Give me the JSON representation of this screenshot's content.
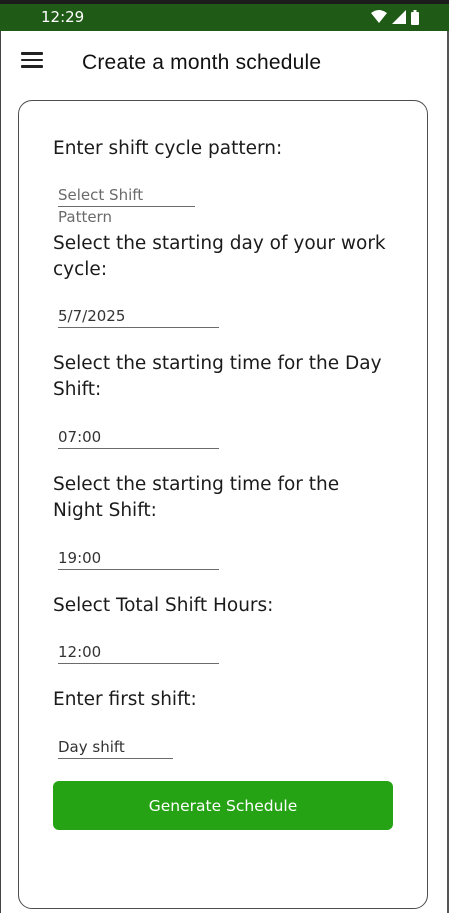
{
  "status_bar": {
    "time": "12:29"
  },
  "header": {
    "title": "Create a month schedule",
    "menu_icon": "hamburger-menu-icon"
  },
  "form": {
    "shift_pattern": {
      "label": "Enter shift cycle pattern:",
      "placeholder": "Select Shift Pattern"
    },
    "start_day": {
      "label": "Select the starting day of your work cycle:",
      "value": "5/7/2025"
    },
    "day_shift_time": {
      "label": "Select the starting time for the Day Shift:",
      "value": "07:00"
    },
    "night_shift_time": {
      "label": "Select the starting time for the Night Shift:",
      "value": "19:00"
    },
    "total_hours": {
      "label": "Select Total Shift Hours:",
      "value": "12:00"
    },
    "first_shift": {
      "label": "Enter first shift:",
      "value": "Day shift"
    },
    "generate_label": "Generate Schedule"
  },
  "colors": {
    "status_bar": "#1f5a16",
    "button": "#26a215"
  }
}
